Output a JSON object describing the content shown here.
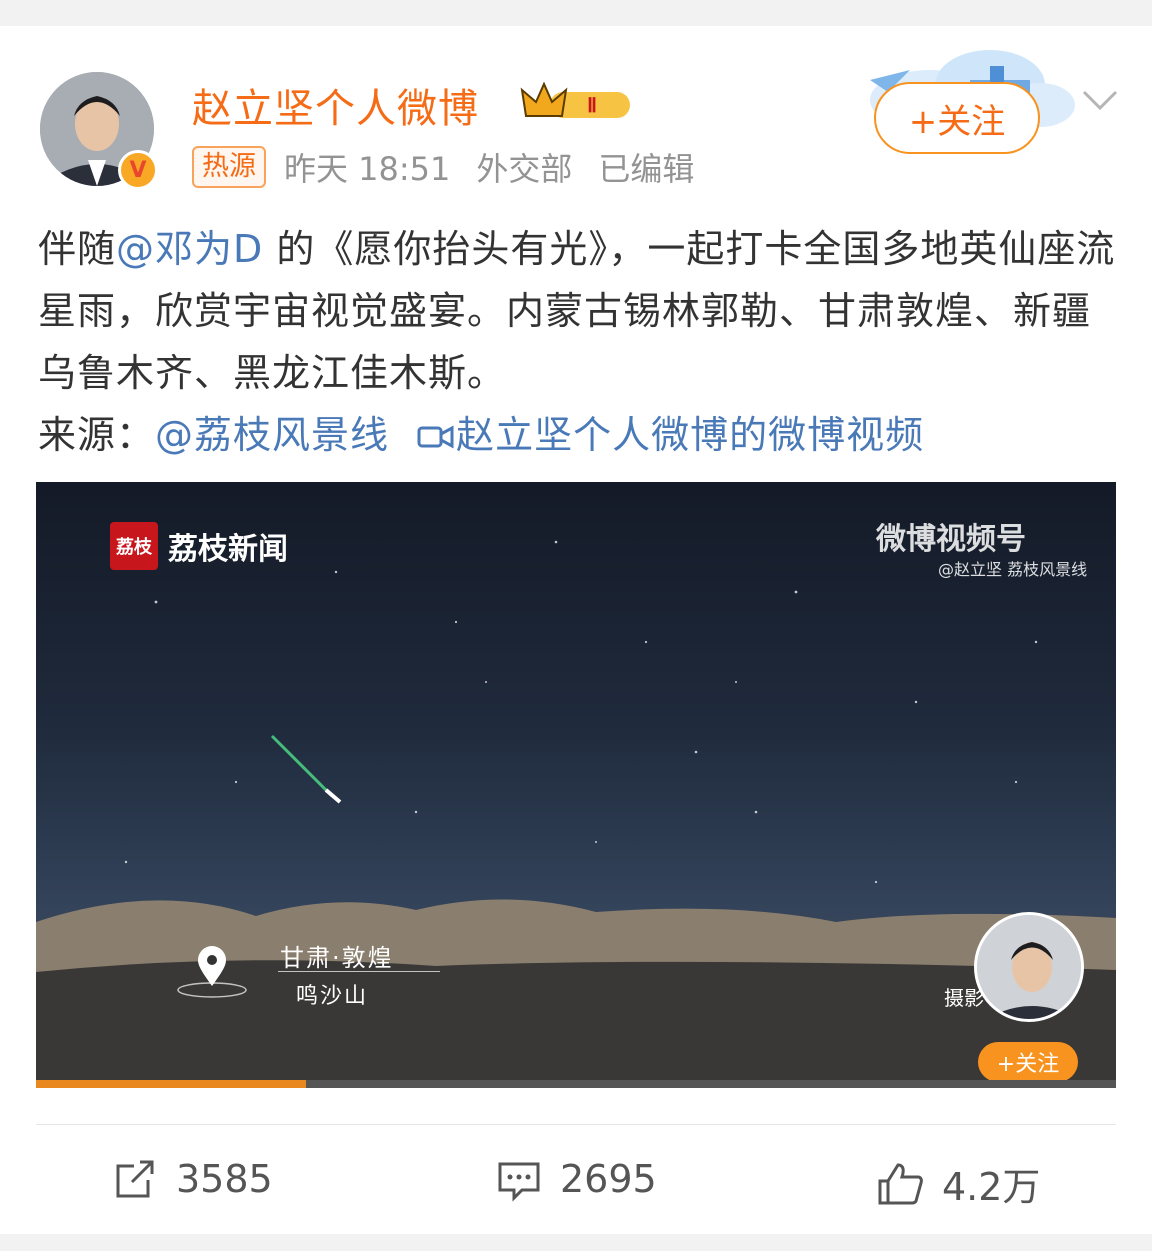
{
  "user": {
    "name": "赵立坚个人微博",
    "level_badge": "Ⅱ",
    "verified_badge": "V",
    "follow_label": "+关注"
  },
  "meta": {
    "hot_tag": "热源",
    "time": "昨天 18:51",
    "source": "外交部",
    "edited": "已编辑"
  },
  "post": {
    "prefix": "伴随",
    "mention": "@邓为D",
    "body": " 的《愿你抬头有光》，一起打卡全国多地英仙座流星雨，欣赏宇宙视觉盛宴。内蒙古锡林郭勒、甘肃敦煌、新疆乌鲁木齐、黑龙江佳木斯。",
    "source_label": "来源：",
    "source_link": "@荔枝风景线",
    "video_link": "赵立坚个人微博的微博视频"
  },
  "video": {
    "brand": "荔枝新闻",
    "brand_icon_text": "荔枝",
    "weibo_mark": "微博视频号",
    "weibo_handle": "@赵立坚 荔枝风景线",
    "location_line1": "甘肃·敦煌",
    "location_line2": "鸣沙山",
    "photo_label": "摄影",
    "mini_follow": "+关注",
    "progress": 0.25
  },
  "actions": {
    "repost": "3585",
    "comment": "2695",
    "like": "4.2万"
  },
  "icons": [
    "verified-icon",
    "crown-icon",
    "chevron-down-icon",
    "video-icon",
    "location-pin-icon",
    "repost-icon",
    "comment-icon",
    "like-icon"
  ],
  "colors": {
    "accent": "#f56b16",
    "link": "#4a79b8",
    "progress": "#e8881e"
  }
}
